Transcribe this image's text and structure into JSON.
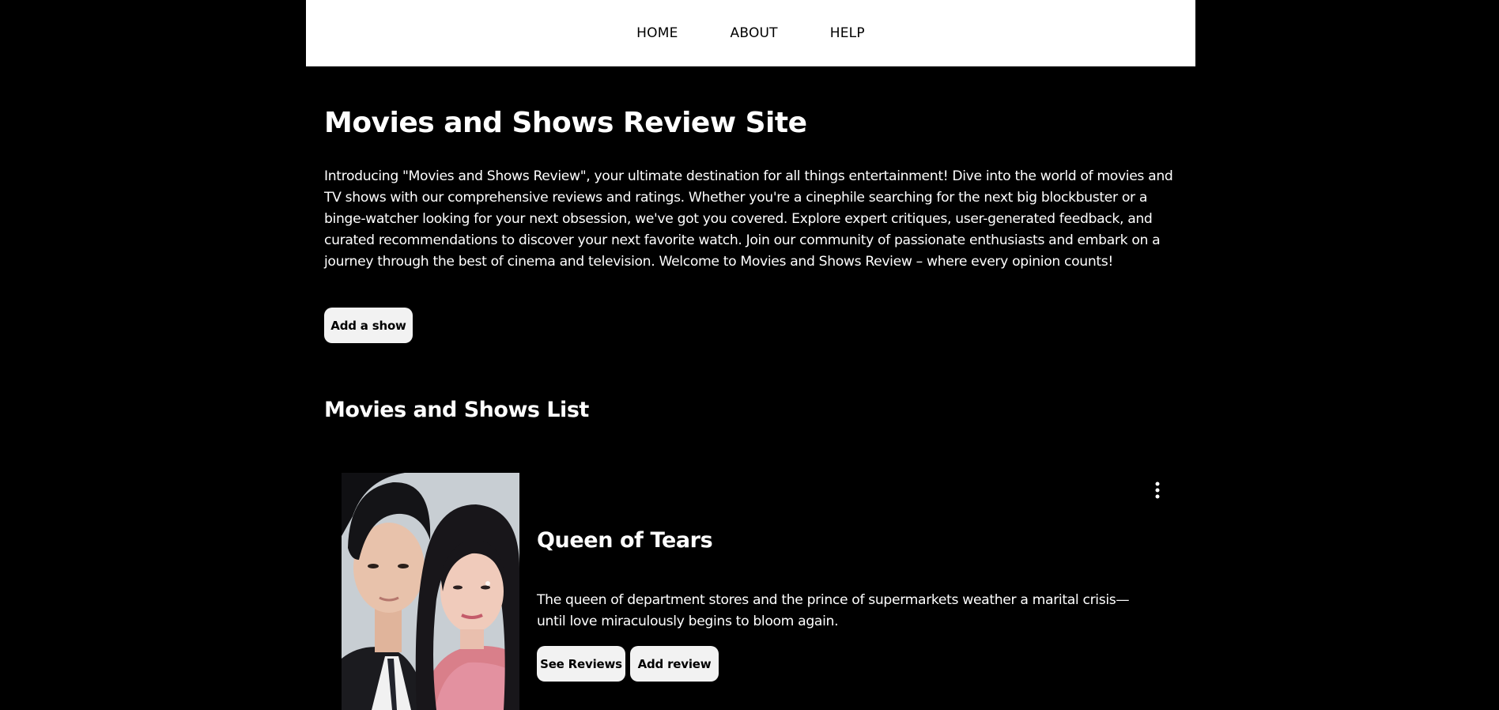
{
  "nav": {
    "items": [
      "HOME",
      "ABOUT",
      "HELP"
    ]
  },
  "header": {
    "title": "Movies and Shows Review Site",
    "intro": "Introducing \"Movies and Shows Review\", your ultimate destination for all things entertainment! Dive into the world of movies and TV shows with our comprehensive reviews and ratings. Whether you're a cinephile searching for the next big blockbuster or a binge-watcher looking for your next obsession, we've got you covered. Explore expert critiques, user-generated feedback, and curated recommendations to discover your next favorite watch. Join our community of passionate enthusiasts and embark on a journey through the best of cinema and television. Welcome to Movies and Shows Review – where every opinion counts!",
    "add_show_label": "Add a show"
  },
  "list": {
    "title": "Movies and Shows List",
    "shows": [
      {
        "title": "Queen of Tears",
        "description": "The queen of department stores and the prince of supermarkets weather a marital crisis—until love miraculously begins to bloom again.",
        "see_reviews_label": "See Reviews",
        "add_review_label": "Add review",
        "poster_icon": "poster-image",
        "menu_icon": "kebab-menu-icon"
      }
    ]
  },
  "colors": {
    "background": "#000000",
    "navbar": "#ffffff",
    "button": "#f2f2f2",
    "text": "#ffffff"
  }
}
